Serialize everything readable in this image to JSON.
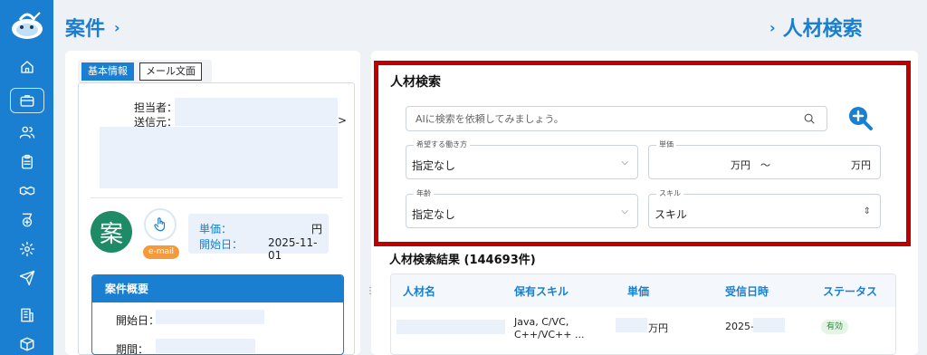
{
  "breadcrumb": {
    "left_title": "案件",
    "right_title": "人材検索",
    "chevron": "›"
  },
  "tabs": [
    {
      "label": "基本情報",
      "active": true
    },
    {
      "label": "メール文面",
      "active": false
    }
  ],
  "info": {
    "tantou_label": "担当者：",
    "sender_label": "送信元：",
    "sender_trail": ">"
  },
  "avatar": {
    "char": "案",
    "email_badge": "e-mail"
  },
  "price_box": {
    "tanka_label": "単価：",
    "tanka_unit": "円",
    "start_label": "開始日：",
    "start_date": "2025-11-01"
  },
  "summary": {
    "header": "案件概要",
    "start_label": "開始日：",
    "period_label": "期間："
  },
  "splitter": "⋮",
  "search": {
    "title": "人材検索",
    "placeholder": "AIに検索を依頼してみましょう。",
    "work_style": {
      "label": "希望する働き方",
      "value": "指定なし"
    },
    "tanka": {
      "label": "単価",
      "unit_min": "万円",
      "tilde": "〜",
      "unit_max": "万円"
    },
    "age": {
      "label": "年齢",
      "value": "指定なし"
    },
    "skill": {
      "label": "スキル",
      "value": "スキル"
    }
  },
  "results": {
    "title": "人材検索結果 (144693件)",
    "columns": [
      "人材名",
      "保有スキル",
      "単価",
      "受信日時",
      "ステータス"
    ],
    "rows": [
      {
        "skills_line1": "Java, C/VC,",
        "skills_line2": "C++/VC++ ...",
        "tanka_unit": "万円",
        "date_prefix": "2025-",
        "status": "有効"
      }
    ]
  },
  "colors": {
    "primary": "#1a7fd0",
    "highlight_frame": "#c00000",
    "avatar_bg": "#1e8a66",
    "email_badge": "#f59a3c",
    "status_bg": "#e4f5e6"
  },
  "sidebar_icons": [
    "logo-mascot",
    "home-icon",
    "briefcase-icon",
    "users-icon",
    "clipboard-icon",
    "handshake-icon",
    "badge-icon",
    "gear-icon",
    "send-icon",
    "building-icon",
    "box-icon"
  ]
}
